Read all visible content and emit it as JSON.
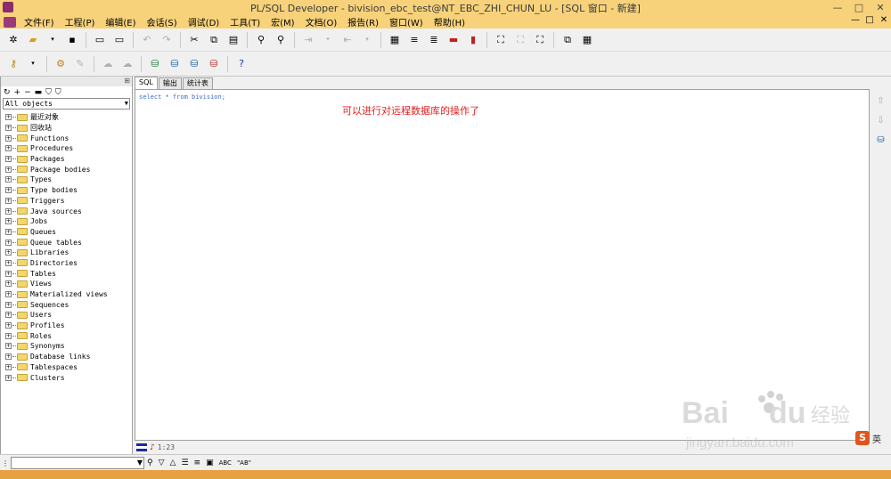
{
  "window": {
    "title": "PL/SQL Developer - bivision_ebc_test@NT_EBC_ZHI_CHUN_LU - [SQL 窗口 - 新建]",
    "controls": [
      "—",
      "□",
      "✕"
    ]
  },
  "menu": {
    "items": [
      "文件(F)",
      "工程(P)",
      "编辑(E)",
      "会话(S)",
      "调试(D)",
      "工具(T)",
      "宏(M)",
      "文档(O)",
      "报告(R)",
      "窗口(W)",
      "帮助(H)"
    ],
    "right_controls": [
      "—",
      "□",
      "✕"
    ]
  },
  "toolbar1": {
    "icons": [
      "new-icon",
      "open-icon",
      "save-icon",
      "print-icon",
      "print-preview-icon",
      "undo-icon",
      "redo-icon",
      "cut-icon",
      "copy-icon",
      "paste-icon",
      "find-icon",
      "replace-icon",
      "indent-icon",
      "unindent-icon",
      "doc-icon",
      "list-icon",
      "list2-icon",
      "export-icon",
      "connect-icon",
      "disconnect-icon",
      "schema-icon",
      "windows-icon",
      "tile-icon"
    ]
  },
  "toolbar2": {
    "icons": [
      "key-icon",
      "execute-icon",
      "break-icon",
      "commit-icon",
      "rollback-icon",
      "db1-icon",
      "db2-icon",
      "db3-icon",
      "db4-icon",
      "help-icon"
    ]
  },
  "object_browser": {
    "filter": "All objects",
    "items": [
      "最近对象",
      "回收站",
      "Functions",
      "Procedures",
      "Packages",
      "Package bodies",
      "Types",
      "Type bodies",
      "Triggers",
      "Java sources",
      "Jobs",
      "Queues",
      "Queue tables",
      "Libraries",
      "Directories",
      "Tables",
      "Views",
      "Materialized views",
      "Sequences",
      "Users",
      "Profiles",
      "Roles",
      "Synonyms",
      "Database links",
      "Tablespaces",
      "Clusters"
    ]
  },
  "editor": {
    "tabs": [
      "SQL",
      "输出",
      "统计表"
    ],
    "active_tab": "SQL",
    "sql": "select * from bivision;",
    "annotation": "可以进行对远程数据库的操作了",
    "annotation_color": "#e02020"
  },
  "status": {
    "position": "1:23"
  },
  "find_bar": {
    "value": ""
  },
  "ime": {
    "logo": "S",
    "lang": "英"
  }
}
